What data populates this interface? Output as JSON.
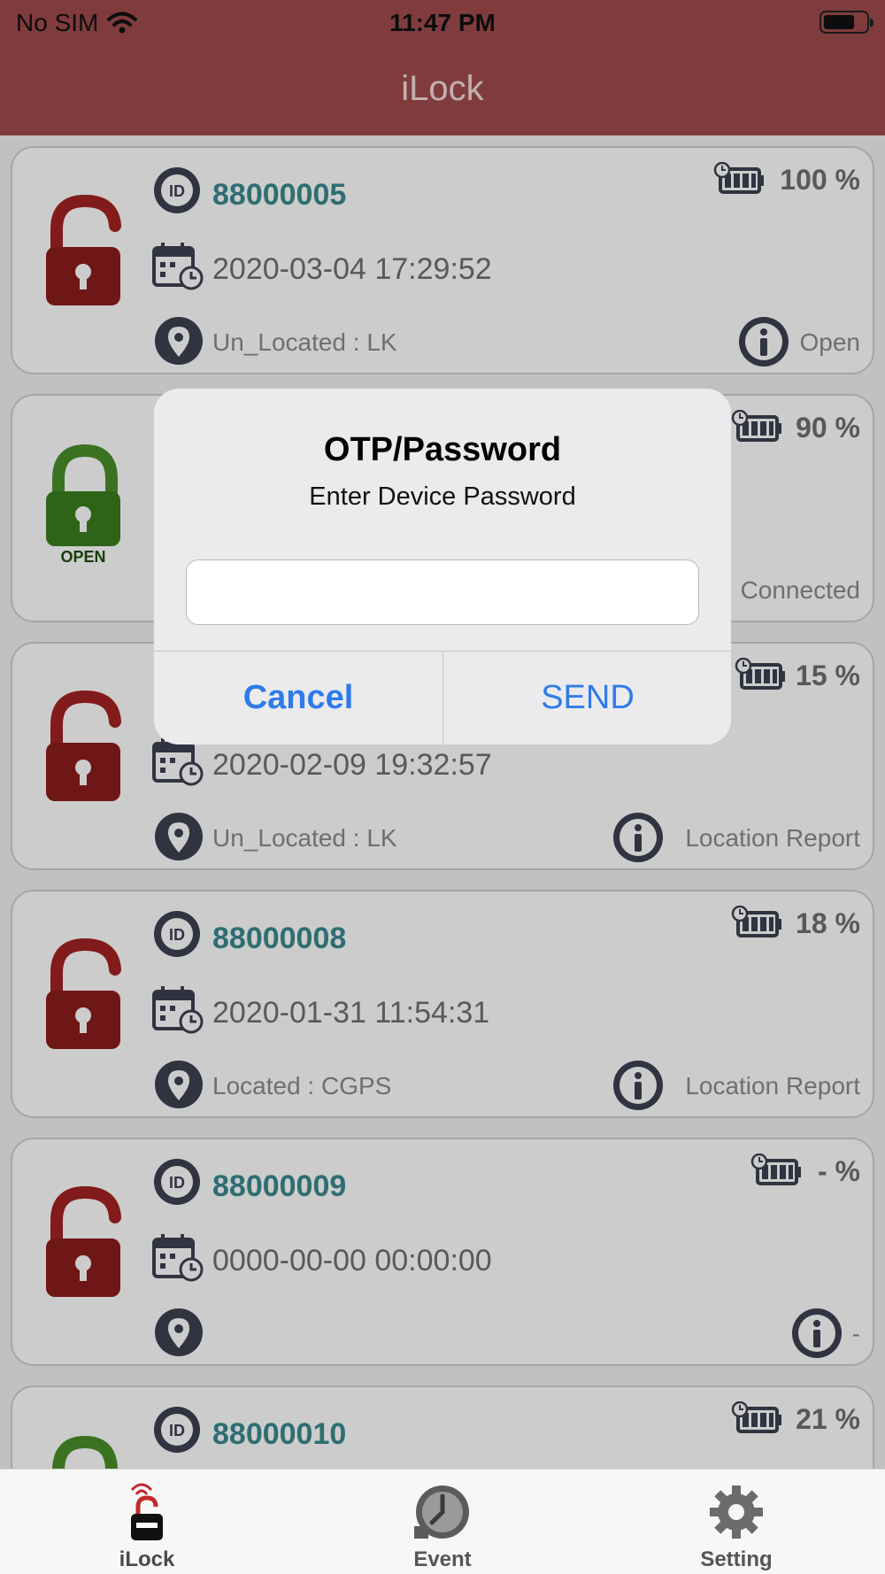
{
  "status_bar": {
    "carrier": "No SIM",
    "time": "11:47 PM"
  },
  "nav": {
    "title": "iLock"
  },
  "devices": [
    {
      "id": "88000005",
      "datetime": "2020-03-04 17:29:52",
      "location": "Un_Located : LK",
      "status": "Open",
      "battery": "100 %",
      "lock_state": "locked"
    },
    {
      "id": "",
      "datetime": "",
      "location": "",
      "status": "Connected",
      "battery": "90 %",
      "lock_state": "open",
      "lock_caption": "OPEN"
    },
    {
      "id": "",
      "datetime": "2020-02-09 19:32:57",
      "location": "Un_Located : LK",
      "status": "Location Report",
      "battery": "15 %",
      "lock_state": "locked"
    },
    {
      "id": "88000008",
      "datetime": "2020-01-31 11:54:31",
      "location": "Located : CGPS",
      "status": "Location Report",
      "battery": "18 %",
      "lock_state": "locked"
    },
    {
      "id": "88000009",
      "datetime": "0000-00-00 00:00:00",
      "location": "",
      "status": "-",
      "battery": "- %",
      "lock_state": "locked"
    },
    {
      "id": "88000010",
      "datetime": "",
      "location": "",
      "status": "",
      "battery": "21 %",
      "lock_state": "open"
    }
  ],
  "dialog": {
    "title": "OTP/Password",
    "message": "Enter Device Password",
    "input_value": "",
    "cancel_label": "Cancel",
    "send_label": "SEND"
  },
  "tabs": [
    {
      "label": "iLock",
      "icon": "ilock-icon",
      "active": true
    },
    {
      "label": "Event",
      "icon": "event-clock-icon",
      "active": false
    },
    {
      "label": "Setting",
      "icon": "gear-icon",
      "active": false
    }
  ],
  "colors": {
    "header": "#a14c4d",
    "id_text": "#3a8a8e",
    "locked_red": "#8b1c1c",
    "open_green": "#3a7d1e",
    "icon_dark": "#3c4252",
    "dialog_button": "#2f7bea"
  }
}
